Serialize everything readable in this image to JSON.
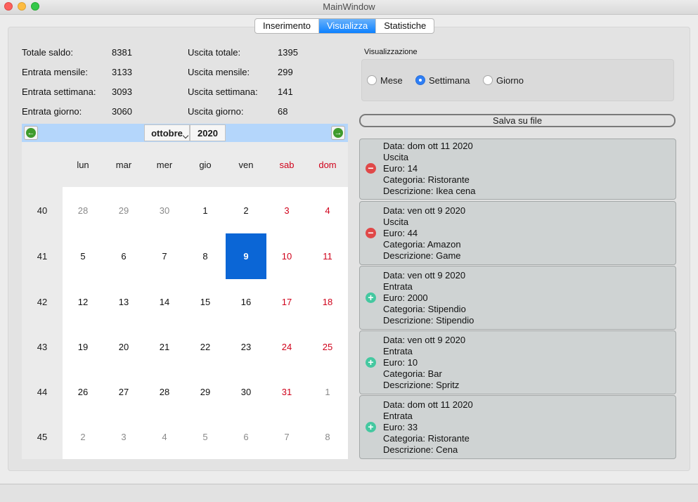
{
  "window": {
    "title": "MainWindow"
  },
  "tabs": [
    {
      "label": "Inserimento",
      "active": false
    },
    {
      "label": "Visualizza",
      "active": true
    },
    {
      "label": "Statistiche",
      "active": false
    }
  ],
  "stats": {
    "totale_saldo": {
      "label": "Totale saldo:",
      "value": "8381"
    },
    "entrata_mensile": {
      "label": "Entrata mensile:",
      "value": "3133"
    },
    "entrata_settimana": {
      "label": "Entrata settimana:",
      "value": "3093"
    },
    "entrata_giorno": {
      "label": "Entrata giorno:",
      "value": "3060"
    },
    "uscita_totale": {
      "label": "Uscita totale:",
      "value": "1395"
    },
    "uscita_mensile": {
      "label": "Uscita mensile:",
      "value": "299"
    },
    "uscita_settimana": {
      "label": "Uscita settimana:",
      "value": "141"
    },
    "uscita_giorno": {
      "label": "Uscita giorno:",
      "value": "68"
    }
  },
  "calendar": {
    "month": "ottobre",
    "year": "2020",
    "weekdays": [
      "lun",
      "mar",
      "mer",
      "gio",
      "ven",
      "sab",
      "dom"
    ],
    "weekend_color": "#d0021b",
    "selected_color": "#0b66d6",
    "weeks": [
      {
        "num": "40",
        "days": [
          "28",
          "29",
          "30",
          "1",
          "2",
          "3",
          "4"
        ],
        "other": [
          true,
          true,
          true,
          false,
          false,
          false,
          false
        ]
      },
      {
        "num": "41",
        "days": [
          "5",
          "6",
          "7",
          "8",
          "9",
          "10",
          "11"
        ],
        "other": [
          false,
          false,
          false,
          false,
          false,
          false,
          false
        ]
      },
      {
        "num": "42",
        "days": [
          "12",
          "13",
          "14",
          "15",
          "16",
          "17",
          "18"
        ],
        "other": [
          false,
          false,
          false,
          false,
          false,
          false,
          false
        ]
      },
      {
        "num": "43",
        "days": [
          "19",
          "20",
          "21",
          "22",
          "23",
          "24",
          "25"
        ],
        "other": [
          false,
          false,
          false,
          false,
          false,
          false,
          false
        ]
      },
      {
        "num": "44",
        "days": [
          "26",
          "27",
          "28",
          "29",
          "30",
          "31",
          "1"
        ],
        "other": [
          false,
          false,
          false,
          false,
          false,
          false,
          true
        ]
      },
      {
        "num": "45",
        "days": [
          "2",
          "3",
          "4",
          "5",
          "6",
          "7",
          "8"
        ],
        "other": [
          true,
          true,
          true,
          true,
          true,
          true,
          true
        ]
      }
    ],
    "selected_day": "9"
  },
  "visualizzazione": {
    "label": "Visualizzazione",
    "options": [
      {
        "label": "Mese",
        "checked": false
      },
      {
        "label": "Settimana",
        "checked": true
      },
      {
        "label": "Giorno",
        "checked": false
      }
    ]
  },
  "save_button": "Salva su file",
  "entries": [
    {
      "type": "uscita",
      "icon": "minus-circle-icon",
      "lines": [
        "Data: dom ott 11 2020",
        "Uscita",
        "Euro: 14",
        "Categoria: Ristorante",
        "Descrizione: Ikea cena"
      ]
    },
    {
      "type": "uscita",
      "icon": "minus-circle-icon",
      "lines": [
        "Data: ven ott 9 2020",
        "Uscita",
        "Euro: 44",
        "Categoria: Amazon",
        "Descrizione: Game"
      ]
    },
    {
      "type": "entrata",
      "icon": "plus-circle-icon",
      "lines": [
        "Data: ven ott 9 2020",
        "Entrata",
        "Euro: 2000",
        "Categoria: Stipendio",
        "Descrizione: Stipendio"
      ]
    },
    {
      "type": "entrata",
      "icon": "plus-circle-icon",
      "lines": [
        "Data: ven ott 9 2020",
        "Entrata",
        "Euro: 10",
        "Categoria: Bar",
        "Descrizione: Spritz"
      ]
    },
    {
      "type": "entrata",
      "icon": "plus-circle-icon",
      "lines": [
        "Data: dom ott 11 2020",
        "Entrata",
        "Euro: 33",
        "Categoria: Ristorante",
        "Descrizione: Cena"
      ]
    }
  ]
}
